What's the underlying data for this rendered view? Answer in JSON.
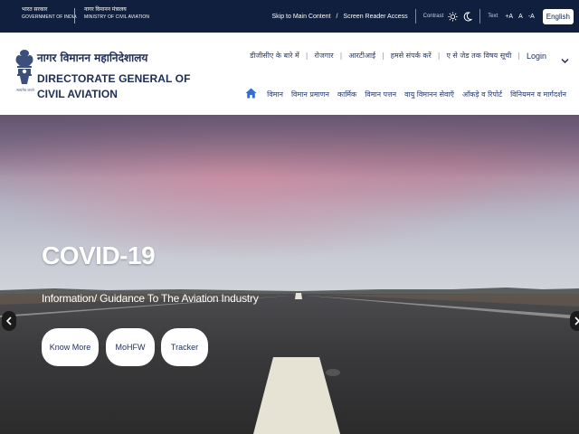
{
  "topbar": {
    "gov_india_hi": "भारत सरकार",
    "gov_india_en": "GOVERNMENT OF INDIA",
    "moca_hi": "नागर विमानन मंत्रालय",
    "moca_en": "MINISTRY OF CIVIL AVIATION",
    "skip": "Skip to Main Content",
    "sep": "/",
    "screen_reader": "Screen Reader Access",
    "contrast": "Contrast",
    "text_label": "Text",
    "font_plus": "+A",
    "font_normal": "A",
    "font_minus": "-A",
    "language": "English"
  },
  "header": {
    "org_hi": "नागर विमानन महानिदेशालय",
    "org_en_line1": "DIRECTORATE GENERAL OF",
    "org_en_line2": "CIVIL AVIATION",
    "emblem_caption": "सत्यमेव जयते",
    "links": [
      "डीजीसीए के बारे में",
      "रोजगार",
      "आरटीआई",
      "हमसे संपर्क करें",
      "ए से जेड तक विषय सूची"
    ],
    "link_sep": "|",
    "login": "Login"
  },
  "nav": {
    "items": [
      "विमान",
      "विमान प्रमाणन",
      "कार्मिक",
      "विमान पत्तन",
      "वायु विमानन सेवाएँ",
      "आँकड़े व रिपोर्ट",
      "विनियमन व मार्गदर्शन"
    ]
  },
  "hero": {
    "title": "COVID-19",
    "subtitle": "Information/ Guidance To The Aviation Industry",
    "buttons": [
      "Know More",
      "MoHFW",
      "Tracker"
    ]
  },
  "icons": {
    "brightness": "sun-icon",
    "dark_mode": "moon-icon",
    "home": "home-icon",
    "prev": "chevron-left-icon",
    "next": "chevron-right-icon",
    "expand": "chevron-down-icon"
  },
  "colors": {
    "topbar_bg": "#0f1f3d",
    "brand_navy": "#1c2d55",
    "nav_text": "#2a3e6e",
    "home_icon": "#2f6fd6"
  }
}
